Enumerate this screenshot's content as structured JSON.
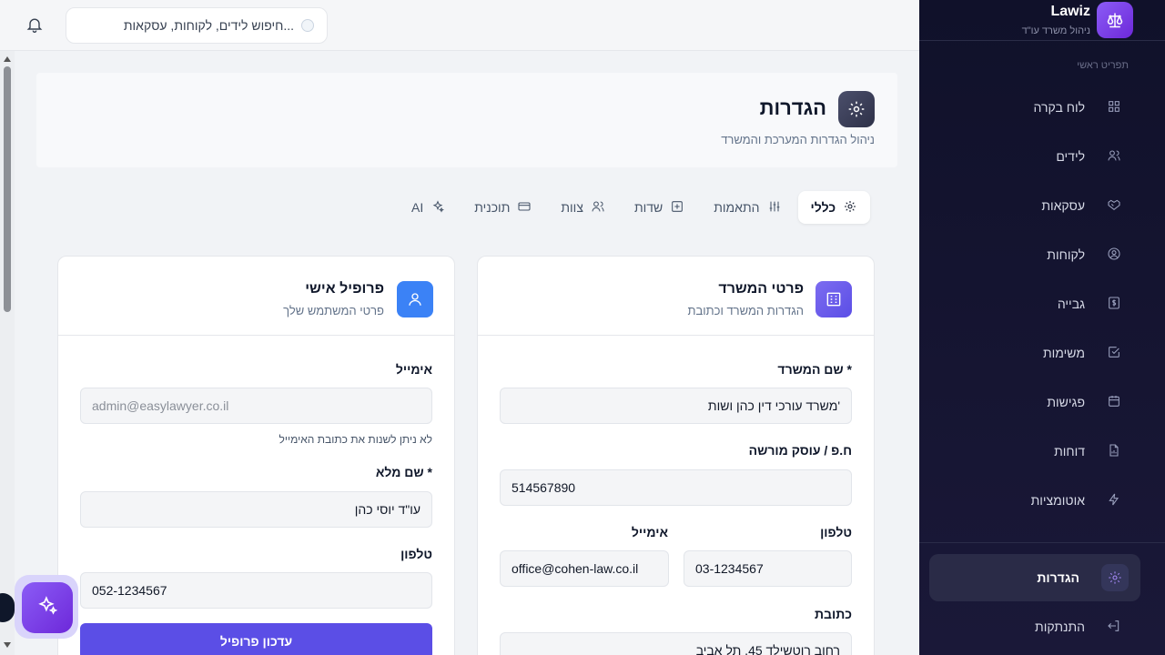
{
  "brand": {
    "name": "Lawiz",
    "subtitle": "ניהול משרד עו\"ד",
    "logo_icon": "scale-icon"
  },
  "sidebar": {
    "caption": "תפריט ראשי",
    "items": [
      {
        "label": "לוח בקרה",
        "icon": "dashboard-icon"
      },
      {
        "label": "לידים",
        "icon": "users-icon"
      },
      {
        "label": "עסקאות",
        "icon": "handshake-icon"
      },
      {
        "label": "לקוחות",
        "icon": "user-circle-icon"
      },
      {
        "label": "גבייה",
        "icon": "dollar-icon"
      },
      {
        "label": "משימות",
        "icon": "checkbox-icon"
      },
      {
        "label": "פגישות",
        "icon": "calendar-icon"
      },
      {
        "label": "דוחות",
        "icon": "file-chart-icon"
      },
      {
        "label": "אוטומציות",
        "icon": "zap-icon"
      }
    ],
    "settings_label": "הגדרות",
    "logout_label": "התנתקות"
  },
  "topbar": {
    "search_placeholder": "חיפוש לידים, לקוחות, עסקאות..."
  },
  "header": {
    "title": "הגדרות",
    "subtitle": "ניהול הגדרות המערכת והמשרד"
  },
  "tabs": [
    {
      "label": "כללי",
      "icon": "gear-icon",
      "active": true
    },
    {
      "label": "התאמות",
      "icon": "sliders-icon",
      "active": false
    },
    {
      "label": "שדות",
      "icon": "plus-square-icon",
      "active": false
    },
    {
      "label": "צוות",
      "icon": "users-icon",
      "active": false
    },
    {
      "label": "תוכנית",
      "icon": "credit-card-icon",
      "active": false
    },
    {
      "label": "AI",
      "icon": "sparkles-icon",
      "active": false
    }
  ],
  "office": {
    "title": "פרטי המשרד",
    "subtitle": "הגדרות המשרד וכתובת",
    "name_label": "שם המשרד *",
    "name_value": "משרד עורכי דין כהן ושות'",
    "id_label": "ח.פ / עוסק מורשה",
    "id_value": "514567890",
    "phone_label": "טלפון",
    "phone_value": "03-1234567",
    "email_label": "אימייל",
    "email_value": "office@cohen-law.co.il",
    "address_label": "כתובת",
    "address_value": "רחוב רוטשילד 45, תל אביב"
  },
  "profile": {
    "title": "פרופיל אישי",
    "subtitle": "פרטי המשתמש שלך",
    "email_label": "אימייל",
    "email_value": "admin@easylawyer.co.il",
    "email_hint": "לא ניתן לשנות את כתובת האימייל",
    "name_label": "שם מלא *",
    "name_value": "עו\"ד יוסי כהן",
    "phone_label": "טלפון",
    "phone_value": "052-1234567",
    "update_button": "עדכון פרופיל"
  },
  "colors": {
    "accent": "#5b4ee6",
    "sidebar_bg": "#10112a",
    "profile_icon": "#3b82f6",
    "office_icon": "#6d5ce8"
  }
}
